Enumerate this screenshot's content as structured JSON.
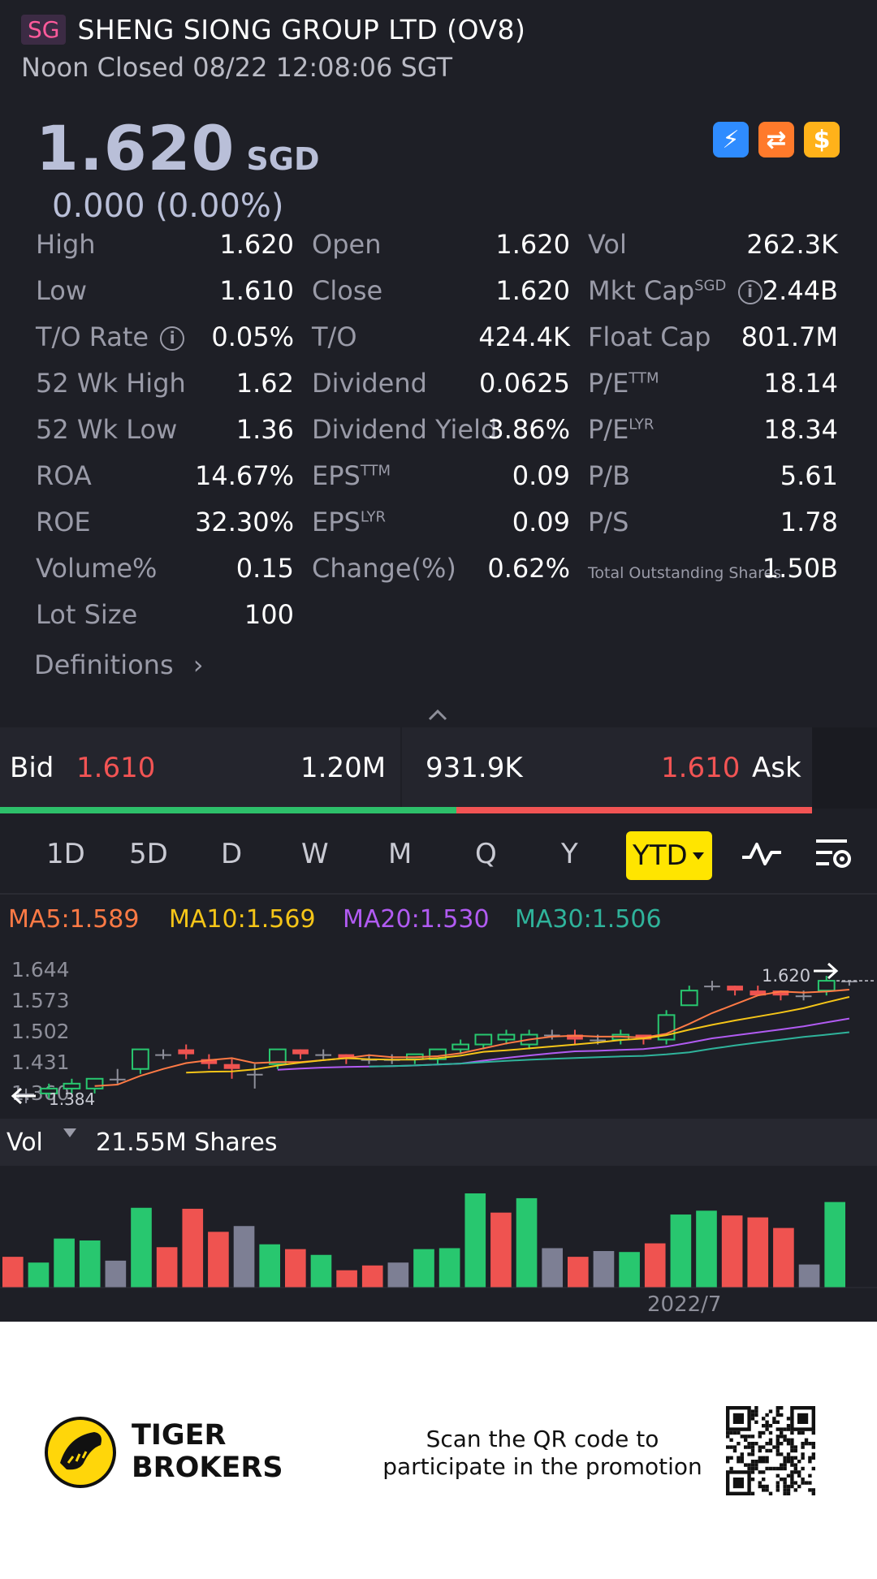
{
  "header": {
    "market_badge": "SG",
    "title": "SHENG SIONG GROUP LTD (OV8)",
    "status": "Noon Closed 08/22 12:08:06 SGT"
  },
  "quote": {
    "price": "1.620",
    "currency": "SGD",
    "change": "0.000 (0.00%)",
    "badges": [
      "lightning-icon",
      "exchange-icon",
      "dollar-icon"
    ]
  },
  "stats": {
    "rows": [
      [
        {
          "label": "High",
          "value": "1.620"
        },
        {
          "label": "Open",
          "value": "1.620"
        },
        {
          "label": "Vol",
          "value": "262.3K"
        }
      ],
      [
        {
          "label": "Low",
          "value": "1.610"
        },
        {
          "label": "Close",
          "value": "1.620"
        },
        {
          "label": "Mkt Cap",
          "sup": "SGD",
          "value": "2.44B"
        }
      ],
      [
        {
          "label": "T/O Rate",
          "value": "0.05%"
        },
        {
          "label": "T/O",
          "value": "424.4K"
        },
        {
          "label": "Float Cap",
          "value": "801.7M"
        }
      ],
      [
        {
          "label": "52 Wk High",
          "value": "1.62"
        },
        {
          "label": "Dividend",
          "value": "0.0625"
        },
        {
          "label": "P/E",
          "sup": "TTM",
          "value": "18.14"
        }
      ],
      [
        {
          "label": "52 Wk Low",
          "value": "1.36"
        },
        {
          "label": "Dividend Yield",
          "value": "3.86%"
        },
        {
          "label": "P/E",
          "sup": "LYR",
          "value": "18.34"
        }
      ],
      [
        {
          "label": "ROA",
          "value": "14.67%"
        },
        {
          "label": "EPS",
          "sup": "TTM",
          "value": "0.09"
        },
        {
          "label": "P/B",
          "value": "5.61"
        }
      ],
      [
        {
          "label": "ROE",
          "value": "32.30%"
        },
        {
          "label": "EPS",
          "sup": "LYR",
          "value": "0.09"
        },
        {
          "label": "P/S",
          "value": "1.78"
        }
      ],
      [
        {
          "label": "Volume%",
          "value": "0.15"
        },
        {
          "label": "Change(%)",
          "value": "0.62%"
        },
        {
          "label": "Total Outstanding Shares",
          "value": "1.50B"
        }
      ],
      [
        {
          "label": "Lot Size",
          "value": "100"
        }
      ]
    ],
    "definitions": "Definitions"
  },
  "bidask": {
    "bid_label": "Bid",
    "bid_price": "1.610",
    "bid_size": "1.20M",
    "ask_size": "931.9K",
    "ask_price": "1.610",
    "ask_label": "Ask",
    "bid_ratio": 0.562
  },
  "periods": {
    "items": [
      "1D",
      "5D",
      "D",
      "W",
      "M",
      "Q",
      "Y"
    ],
    "active": "YTD"
  },
  "ma": {
    "ma5": "MA5:1.589",
    "ma10": "MA10:1.569",
    "ma20": "MA20:1.530",
    "ma30": "MA30:1.506",
    "colors": {
      "ma5": "#ff7a45",
      "ma10": "#f5c518",
      "ma20": "#b15bf2",
      "ma30": "#2fb39b"
    }
  },
  "chart_data": [
    {
      "type": "candlestick",
      "y_ticks": [
        "1.644",
        "1.573",
        "1.502",
        "1.431",
        "1.360"
      ],
      "ylim": [
        1.36,
        1.65
      ],
      "last_label": "1.620",
      "low_label": "1.384",
      "candles": [
        {
          "o": 1.39,
          "c": 1.39,
          "h": 1.4,
          "l": 1.37
        },
        {
          "o": 1.39,
          "c": 1.4,
          "h": 1.41,
          "l": 1.38
        },
        {
          "o": 1.4,
          "c": 1.41,
          "h": 1.42,
          "l": 1.39
        },
        {
          "o": 1.4,
          "c": 1.42,
          "h": 1.42,
          "l": 1.39
        },
        {
          "o": 1.42,
          "c": 1.42,
          "h": 1.44,
          "l": 1.41
        },
        {
          "o": 1.44,
          "c": 1.48,
          "h": 1.48,
          "l": 1.43
        },
        {
          "o": 1.47,
          "c": 1.47,
          "h": 1.48,
          "l": 1.46
        },
        {
          "o": 1.48,
          "c": 1.47,
          "h": 1.49,
          "l": 1.46
        },
        {
          "o": 1.46,
          "c": 1.45,
          "h": 1.47,
          "l": 1.44
        },
        {
          "o": 1.45,
          "c": 1.44,
          "h": 1.46,
          "l": 1.42
        },
        {
          "o": 1.43,
          "c": 1.43,
          "h": 1.45,
          "l": 1.4
        },
        {
          "o": 1.45,
          "c": 1.48,
          "h": 1.48,
          "l": 1.44
        },
        {
          "o": 1.48,
          "c": 1.47,
          "h": 1.48,
          "l": 1.46
        },
        {
          "o": 1.47,
          "c": 1.47,
          "h": 1.48,
          "l": 1.46
        },
        {
          "o": 1.47,
          "c": 1.46,
          "h": 1.47,
          "l": 1.45
        },
        {
          "o": 1.46,
          "c": 1.46,
          "h": 1.47,
          "l": 1.45
        },
        {
          "o": 1.46,
          "c": 1.46,
          "h": 1.47,
          "l": 1.45
        },
        {
          "o": 1.46,
          "c": 1.47,
          "h": 1.47,
          "l": 1.45
        },
        {
          "o": 1.46,
          "c": 1.48,
          "h": 1.48,
          "l": 1.45
        },
        {
          "o": 1.48,
          "c": 1.49,
          "h": 1.5,
          "l": 1.47
        },
        {
          "o": 1.49,
          "c": 1.51,
          "h": 1.51,
          "l": 1.48
        },
        {
          "o": 1.5,
          "c": 1.51,
          "h": 1.52,
          "l": 1.49
        },
        {
          "o": 1.49,
          "c": 1.51,
          "h": 1.52,
          "l": 1.48
        },
        {
          "o": 1.51,
          "c": 1.51,
          "h": 1.52,
          "l": 1.5
        },
        {
          "o": 1.51,
          "c": 1.5,
          "h": 1.52,
          "l": 1.49
        },
        {
          "o": 1.5,
          "c": 1.5,
          "h": 1.51,
          "l": 1.49
        },
        {
          "o": 1.5,
          "c": 1.51,
          "h": 1.52,
          "l": 1.49
        },
        {
          "o": 1.51,
          "c": 1.5,
          "h": 1.51,
          "l": 1.49
        },
        {
          "o": 1.5,
          "c": 1.55,
          "h": 1.56,
          "l": 1.49
        },
        {
          "o": 1.57,
          "c": 1.6,
          "h": 1.61,
          "l": 1.57
        },
        {
          "o": 1.61,
          "c": 1.61,
          "h": 1.62,
          "l": 1.6
        },
        {
          "o": 1.61,
          "c": 1.6,
          "h": 1.61,
          "l": 1.59
        },
        {
          "o": 1.6,
          "c": 1.59,
          "h": 1.61,
          "l": 1.59
        },
        {
          "o": 1.6,
          "c": 1.59,
          "h": 1.6,
          "l": 1.58
        },
        {
          "o": 1.59,
          "c": 1.59,
          "h": 1.6,
          "l": 1.58
        },
        {
          "o": 1.6,
          "c": 1.62,
          "h": 1.63,
          "l": 1.59
        },
        {
          "o": 1.62,
          "c": 1.62,
          "h": 1.62,
          "l": 1.61
        }
      ]
    },
    {
      "type": "bar",
      "title": "Vol",
      "total": "21.55M Shares",
      "x_tick": "2022/7",
      "values": [
        3.2,
        2.6,
        5.1,
        4.9,
        2.8,
        8.3,
        4.2,
        8.2,
        5.8,
        6.4,
        4.5,
        4.0,
        3.4,
        1.8,
        2.3,
        2.6,
        4.0,
        4.1,
        9.8,
        7.8,
        9.3,
        4.1,
        3.2,
        3.8,
        3.7,
        4.6,
        7.6,
        8.0,
        7.5,
        7.3,
        6.2,
        2.4,
        8.9
      ],
      "colors": [
        "r",
        "g",
        "g",
        "g",
        "n",
        "g",
        "r",
        "r",
        "r",
        "n",
        "g",
        "r",
        "g",
        "r",
        "r",
        "n",
        "g",
        "g",
        "g",
        "r",
        "g",
        "n",
        "r",
        "n",
        "g",
        "r",
        "g",
        "g",
        "r",
        "r",
        "r",
        "n",
        "g"
      ],
      "palette": {
        "g": "#28c76f",
        "r": "#ef5350",
        "n": "#7d7f94"
      }
    }
  ],
  "footer": {
    "brand_line1": "TIGER",
    "brand_line2": "BROKERS",
    "promo_line1": "Scan the QR code to",
    "promo_line2": "participate in the promotion"
  }
}
